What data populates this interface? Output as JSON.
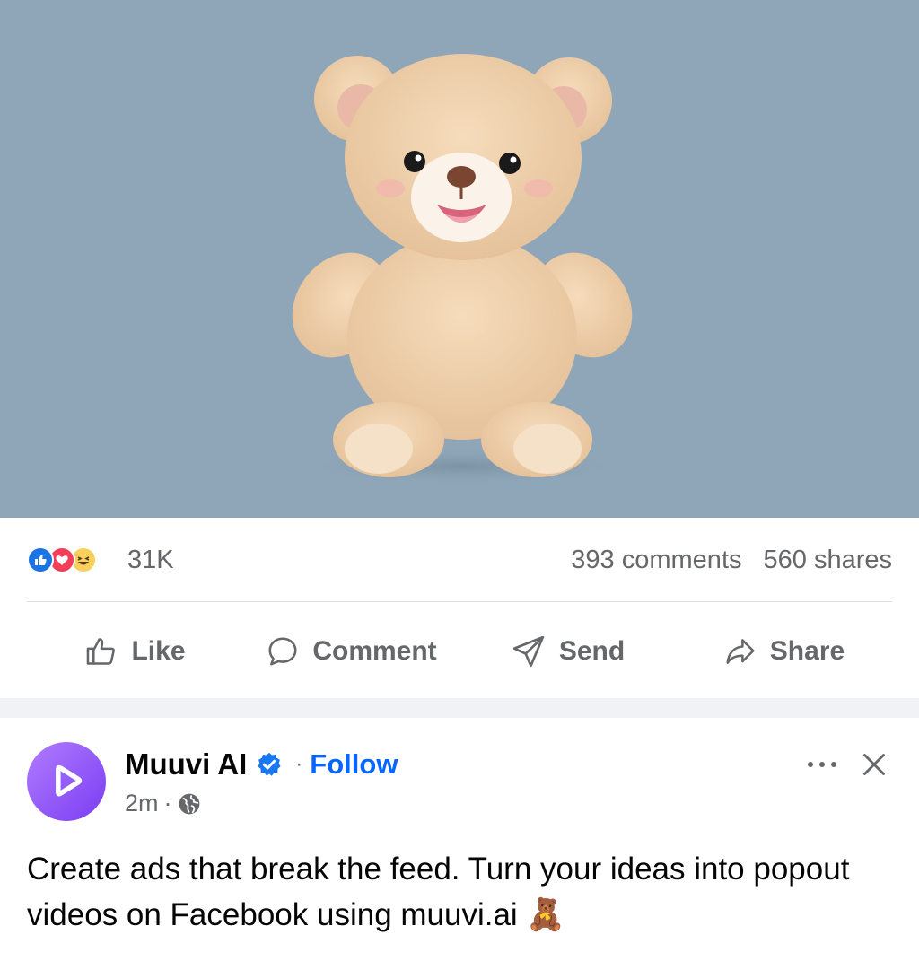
{
  "media": {
    "alt_icon": "teddy-bear-image",
    "background": "#8fa6b8"
  },
  "stats": {
    "reactions": [
      "like-icon",
      "love-icon",
      "haha-icon"
    ],
    "reaction_count": "31K",
    "comments": "393 comments",
    "shares": "560 shares"
  },
  "actions": {
    "like": "Like",
    "comment": "Comment",
    "send": "Send",
    "share": "Share"
  },
  "post": {
    "author": "Muuvi AI",
    "separator": "·",
    "follow": "Follow",
    "time": "2m",
    "time_separator": "·",
    "audience_icon": "globe-icon",
    "text": "Create ads that break the feed. Turn your ideas into popout videos on Facebook using muuvi.ai 🧸"
  },
  "colors": {
    "accent": "#0866ff",
    "muted": "#65676b",
    "avatar": "#8b4cf5"
  }
}
